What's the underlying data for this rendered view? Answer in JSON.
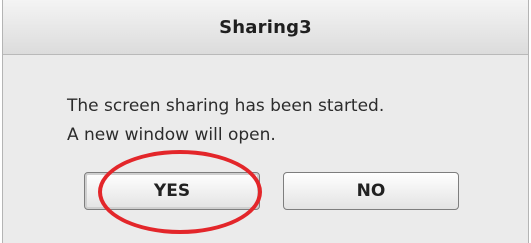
{
  "dialog": {
    "title": "Sharing3",
    "message_line1": "The screen sharing has been started.",
    "message_line2": "A new window will open.",
    "yes_label": "YES",
    "no_label": "NO"
  },
  "colors": {
    "highlight": "#e3262a",
    "dialog_background": "#ebebeb"
  }
}
